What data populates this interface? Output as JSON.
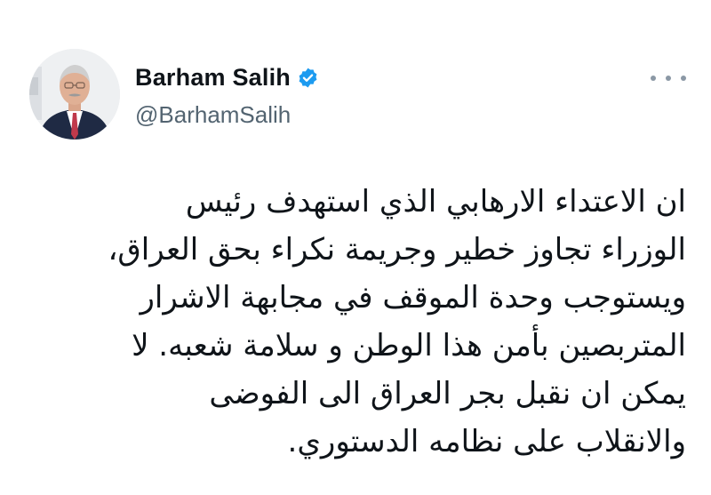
{
  "author": {
    "display_name": "Barham Salih",
    "handle": "@BarhamSalih",
    "verified": true,
    "verified_color": "#1d9bf0"
  },
  "icons": {
    "more": "more-horizontal-icon",
    "verified": "verified-badge-icon"
  },
  "tweet": {
    "lines": [
      "ان الاعتداء الارهابي الذي استهدف رئيس",
      "الوزراء تجاوز خطير وجريمة نكراء بحق العراق،",
      "ويستوجب وحدة الموقف في مجابهة الاشرار",
      "المتربصين بأمن هذا الوطن و سلامة شعبه. لا",
      "يمكن ان نقبل بجر العراق الى الفوضى",
      "والانقلاب على نظامه الدستوري."
    ]
  }
}
